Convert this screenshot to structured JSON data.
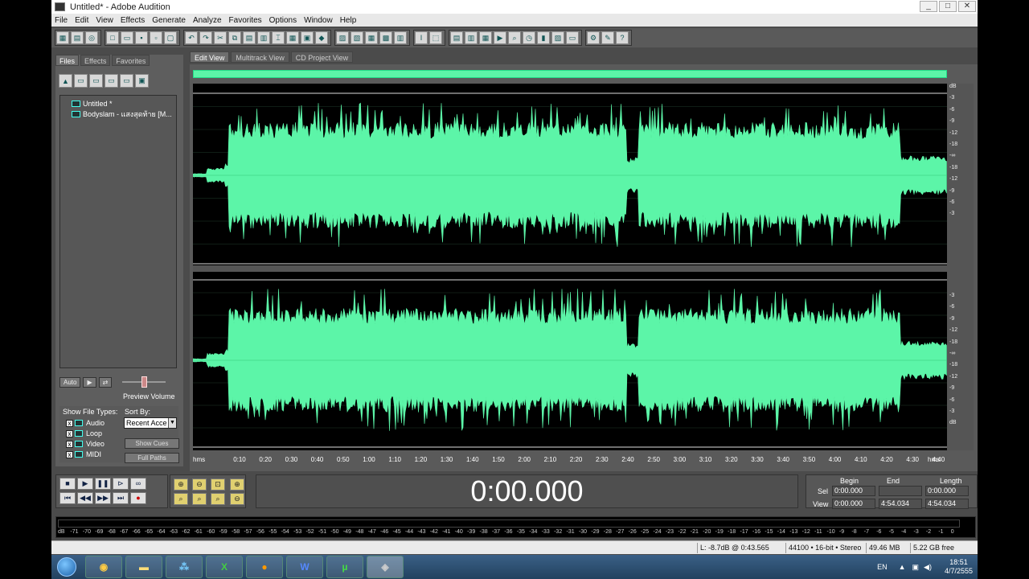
{
  "window": {
    "title": "Untitled* - Adobe Audition",
    "controls": [
      "_",
      "□",
      "✕"
    ]
  },
  "menu": [
    "File",
    "Edit",
    "View",
    "Effects",
    "Generate",
    "Analyze",
    "Favorites",
    "Options",
    "Window",
    "Help"
  ],
  "left_panel": {
    "tabs": [
      "Files",
      "Effects",
      "Favorites"
    ],
    "files": [
      "Untitled *",
      "Bodyslam - แสงสุดท้าย [M..."
    ],
    "auto_label": "Auto",
    "preview_volume_label": "Preview Volume",
    "show_file_types_label": "Show File Types:",
    "sort_by_label": "Sort By:",
    "sort_value": "Recent Acce",
    "file_types": [
      "Audio",
      "Loop",
      "Video",
      "MIDI"
    ],
    "show_cues_label": "Show Cues",
    "full_paths_label": "Full Paths"
  },
  "view_tabs": [
    "Edit View",
    "Multitrack View",
    "CD Project View"
  ],
  "db_scale_top": [
    "dB",
    "-3",
    "-6",
    "-9",
    "-12",
    "-18",
    "-∞",
    "-18",
    "-12",
    "-9",
    "-6",
    "-3"
  ],
  "db_scale_bottom": [
    "-3",
    "-6",
    "-9",
    "-12",
    "-18",
    "-∞",
    "-18",
    "-12",
    "-9",
    "-6",
    "-3",
    "dB"
  ],
  "time_axis": [
    "hms",
    "0:10",
    "0:20",
    "0:30",
    "0:40",
    "0:50",
    "1:00",
    "1:10",
    "1:20",
    "1:30",
    "1:40",
    "1:50",
    "2:00",
    "2:10",
    "2:20",
    "2:30",
    "2:40",
    "2:50",
    "3:00",
    "3:10",
    "3:20",
    "3:30",
    "3:40",
    "3:50",
    "4:00",
    "4:10",
    "4:20",
    "4:30",
    "4:40",
    "hms"
  ],
  "time_display": "0:00.000",
  "selection": {
    "headers": [
      "Begin",
      "End",
      "Length"
    ],
    "sel_label": "Sel",
    "view_label": "View",
    "sel": [
      "0:00.000",
      "",
      "0:00.000"
    ],
    "view": [
      "0:00.000",
      "4:54.034",
      "4:54.034"
    ]
  },
  "meter_scale": [
    "dB",
    "-71",
    "-70",
    "-69",
    "-68",
    "-67",
    "-66",
    "-65",
    "-64",
    "-63",
    "-62",
    "-61",
    "-60",
    "-59",
    "-58",
    "-57",
    "-56",
    "-55",
    "-54",
    "-53",
    "-52",
    "-51",
    "-50",
    "-49",
    "-48",
    "-47",
    "-46",
    "-45",
    "-44",
    "-43",
    "-42",
    "-41",
    "-40",
    "-39",
    "-38",
    "-37",
    "-36",
    "-35",
    "-34",
    "-33",
    "-32",
    "-31",
    "-30",
    "-29",
    "-28",
    "-27",
    "-26",
    "-25",
    "-24",
    "-23",
    "-22",
    "-21",
    "-20",
    "-19",
    "-18",
    "-17",
    "-16",
    "-15",
    "-14",
    "-13",
    "-12",
    "-11",
    "-10",
    "-9",
    "-8",
    "-7",
    "-6",
    "-5",
    "-4",
    "-3",
    "-2",
    "-1",
    "0"
  ],
  "status": {
    "level": "L: -8.7dB @   0:43.565",
    "format": "44100 • 16-bit • Stereo",
    "size": "49.46 MB",
    "free": "5.22 GB free"
  },
  "taskbar": {
    "lang": "EN",
    "time": "18:51",
    "date": "4/7/2555",
    "apps": [
      "chrome-icon",
      "folder-icon",
      "network-icon",
      "excel-icon",
      "orange-ball-icon",
      "word-icon",
      "torrent-icon",
      "audition-icon"
    ]
  },
  "colors": {
    "waveform": "#5cf5a8",
    "background": "#000000",
    "panel": "#5a5a5a"
  }
}
